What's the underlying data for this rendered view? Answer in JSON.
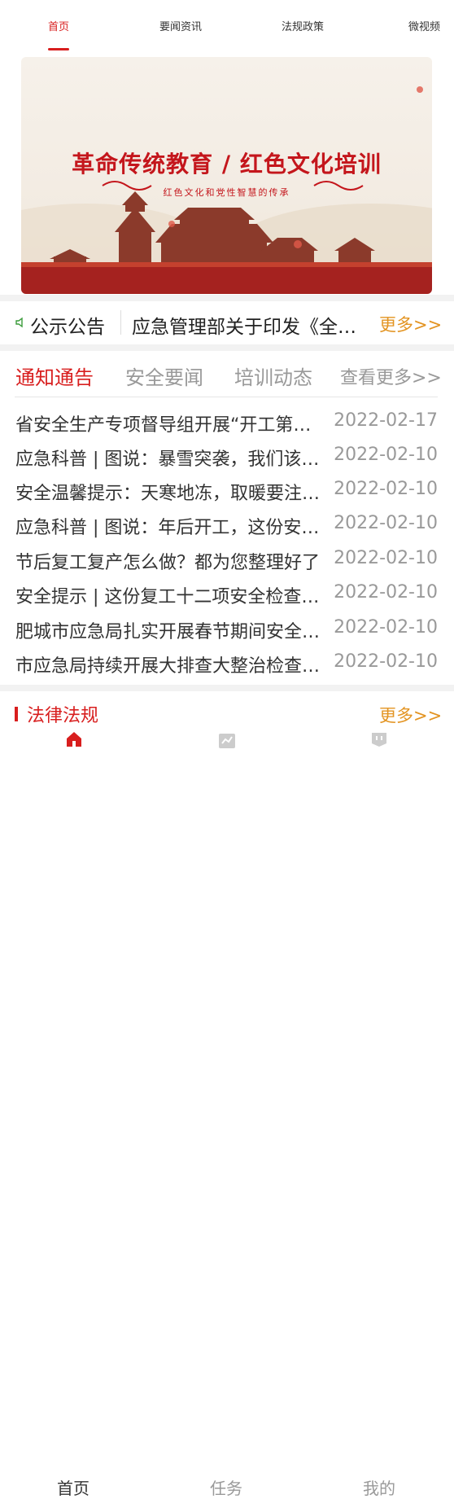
{
  "top_tabs": [
    "首页",
    "要闻资讯",
    "法规政策",
    "微视频"
  ],
  "banner": {
    "title": "革命传统教育 / 红色文化培训",
    "subtitle": "红色文化和党性智慧的传承"
  },
  "notice": {
    "label": "公示公告",
    "text": "应急管理部关于印发《全国安全生产专项整治三年行动计划》的通知",
    "more": "更多>>"
  },
  "news_tabs": [
    "通知通告",
    "安全要闻",
    "培训动态"
  ],
  "news_more": "查看更多>>",
  "news": [
    {
      "title": "省安全生产专项督导组开展“开工第一课”活动",
      "date": "2022-02-17"
    },
    {
      "title": "应急科普 | 图说：暴雪突袭，我们该如何应对",
      "date": "2022-02-10"
    },
    {
      "title": "安全温馨提示：天寒地冻，取暖要注意安全",
      "date": "2022-02-10"
    },
    {
      "title": "应急科普 | 图说：年后开工，这份安全提示请收好",
      "date": "2022-02-10"
    },
    {
      "title": "节后复工复产怎么做？都为您整理好了",
      "date": "2022-02-10"
    },
    {
      "title": "安全提示 | 这份复工十二项安全检查清单请收好",
      "date": "2022-02-10"
    },
    {
      "title": "肥城市应急局扎实开展春节期间安全生产工作",
      "date": "2022-02-10"
    },
    {
      "title": "市应急局持续开展大排查大整治检查行动",
      "date": "2022-02-10"
    }
  ],
  "law": {
    "title": "法律法规",
    "more": "更多>>"
  },
  "bottom_nav": [
    "首页",
    "任务",
    "我的"
  ],
  "colors": {
    "accent": "#d81e1e",
    "more": "#e39422"
  }
}
